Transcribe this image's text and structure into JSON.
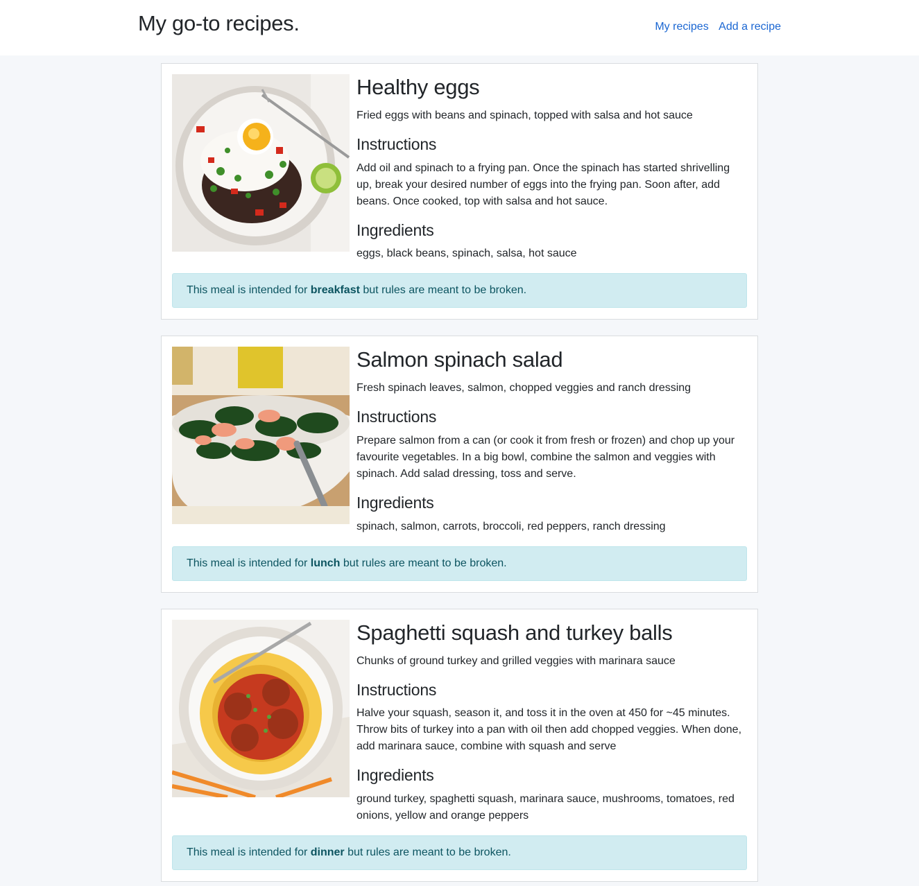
{
  "header": {
    "title": "My go-to recipes.",
    "nav": [
      {
        "label": "My recipes"
      },
      {
        "label": "Add a recipe"
      }
    ]
  },
  "labels": {
    "instructions_heading": "Instructions",
    "ingredients_heading": "Ingredients",
    "alert_prefix": "This meal is intended for",
    "alert_suffix": "but rules are meant to be broken."
  },
  "recipes": [
    {
      "title": "Healthy eggs",
      "description": "Fried eggs with beans and spinach, topped with salsa and hot sauce",
      "instructions": "Add oil and spinach to a frying pan. Once the spinach has started shrivelling up, break your desired number of eggs into the frying pan. Soon after, add beans. Once cooked, top with salsa and hot sauce.",
      "ingredients": "eggs, black beans, spinach, salsa, hot sauce",
      "meal": "breakfast",
      "image": "fried-eggs-plate"
    },
    {
      "title": "Salmon spinach salad",
      "description": "Fresh spinach leaves, salmon, chopped veggies and ranch dressing",
      "instructions": "Prepare salmon from a can (or cook it from fresh or frozen) and chop up your favourite vegetables. In a big bowl, combine the salmon and veggies with spinach. Add salad dressing, toss and serve.",
      "ingredients": "spinach, salmon, carrots, broccoli, red peppers, ranch dressing",
      "meal": "lunch",
      "image": "salmon-salad-bowl"
    },
    {
      "title": "Spaghetti squash and turkey balls",
      "description": "Chunks of ground turkey and grilled veggies with marinara sauce",
      "instructions": "Halve your squash, season it, and toss it in the oven at 450 for ~45 minutes. Throw bits of turkey into a pan with oil then add chopped veggies. When done, add marinara sauce, combine with squash and serve",
      "ingredients": "ground turkey, spaghetti squash, marinara sauce, mushrooms, tomatoes, red onions, yellow and orange peppers",
      "meal": "dinner",
      "image": "spaghetti-squash-meatballs"
    }
  ]
}
